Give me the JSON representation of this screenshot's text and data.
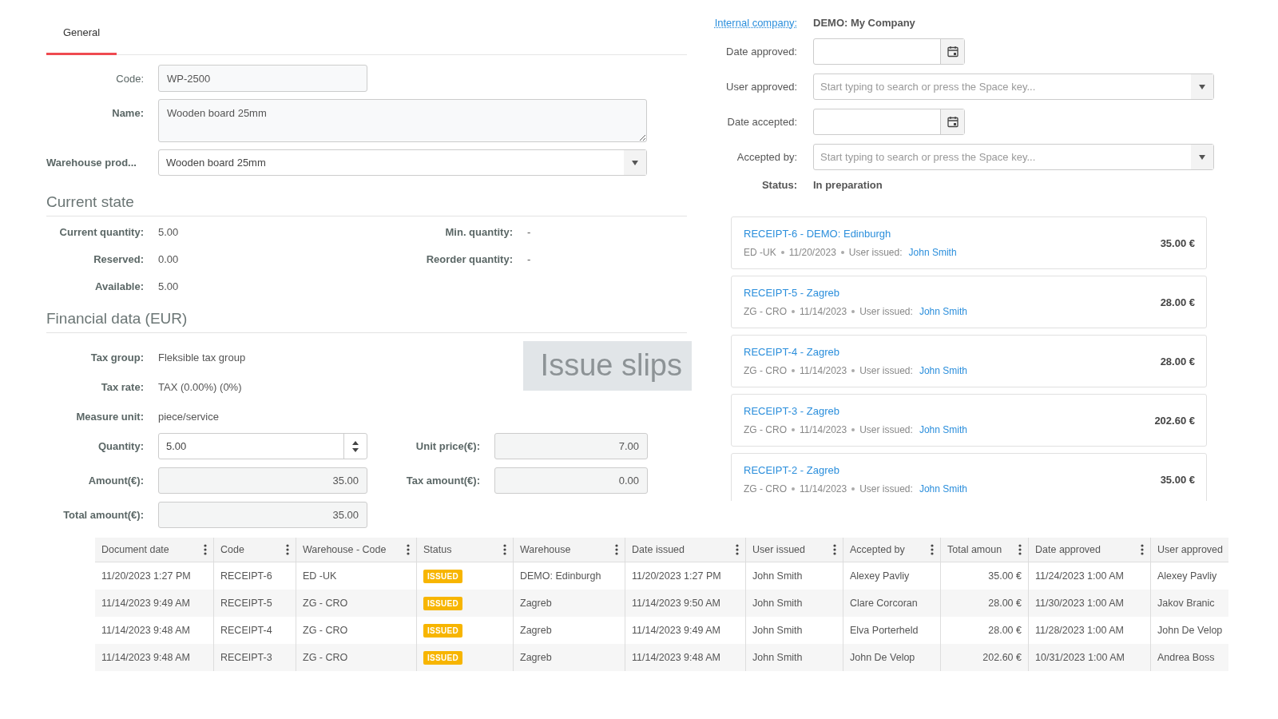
{
  "tabs": [
    {
      "label": "General",
      "selected": true
    }
  ],
  "form": {
    "code": {
      "label": "Code:",
      "value": "WP-2500"
    },
    "name": {
      "label": "Name:",
      "value": "Wooden board 25mm"
    },
    "warehouse_product": {
      "label": "Warehouse prod...",
      "value": "Wooden board 25mm"
    }
  },
  "current_state": {
    "title": "Current state",
    "rows": [
      {
        "label": "Current quantity:",
        "value": "5.00",
        "label_2": "Min. quantity:",
        "value_2": "-"
      },
      {
        "label": "Reserved:",
        "value": "0.00",
        "label_2": "Reorder quantity:",
        "value_2": "-"
      },
      {
        "label": "Available:",
        "value": "5.00"
      }
    ]
  },
  "financial": {
    "title": "Financial data (EUR)",
    "info": [
      {
        "label": "Tax group:",
        "value": "Fleksible tax group"
      },
      {
        "label": "Tax rate:",
        "value": "TAX (0.00%) (0%)"
      },
      {
        "label": "Measure unit:",
        "value": "piece/service"
      }
    ],
    "quantity": {
      "label": "Quantity:",
      "value": "5.00"
    },
    "unit_price": {
      "label": "Unit price(€):",
      "value": "7.00"
    },
    "amount": {
      "label": "Amount(€):",
      "value": "35.00"
    },
    "tax_amount": {
      "label": "Tax amount(€):",
      "value": "0.00"
    },
    "total_amount": {
      "label": "Total amount(€):",
      "value": "35.00"
    }
  },
  "overlay_label": "Issue slips",
  "approval": {
    "internal_company": {
      "label": "Internal company:",
      "value": "DEMO: My Company"
    },
    "fields": [
      {
        "kind": "date",
        "label": "Date approved:"
      },
      {
        "kind": "select",
        "label": "User approved:",
        "placeholder": "Start typing to search or press the Space key..."
      },
      {
        "kind": "date",
        "label": "Date accepted:"
      },
      {
        "kind": "select",
        "label": "Accepted by:",
        "placeholder": "Start typing to search or press the Space key..."
      }
    ],
    "status": {
      "label": "Status:",
      "value": "In preparation"
    }
  },
  "receipts": [
    {
      "title": "RECEIPT-6 - DEMO: Edinburgh",
      "warehouse_code": "ED -UK",
      "date": "11/20/2023",
      "user_label": "User issued:",
      "user": "John Smith",
      "amount": "35.00 €"
    },
    {
      "title": "RECEIPT-5 - Zagreb",
      "warehouse_code": "ZG - CRO",
      "date": "11/14/2023",
      "user_label": "User issued:",
      "user": "John Smith",
      "amount": "28.00 €"
    },
    {
      "title": "RECEIPT-4 - Zagreb",
      "warehouse_code": "ZG - CRO",
      "date": "11/14/2023",
      "user_label": "User issued:",
      "user": "John Smith",
      "amount": "28.00 €"
    },
    {
      "title": "RECEIPT-3 - Zagreb",
      "warehouse_code": "ZG - CRO",
      "date": "11/14/2023",
      "user_label": "User issued:",
      "user": "John Smith",
      "amount": "202.60 €"
    },
    {
      "title": "RECEIPT-2 - Zagreb",
      "warehouse_code": "ZG - CRO",
      "date": "11/14/2023",
      "user_label": "User issued:",
      "user": "John Smith",
      "amount": "35.00 €"
    }
  ],
  "table": {
    "columns": [
      {
        "label": "Document date",
        "kind": "text"
      },
      {
        "label": "Code",
        "kind": "text"
      },
      {
        "label": "Warehouse - Code",
        "kind": "text"
      },
      {
        "label": "Status",
        "kind": "badge"
      },
      {
        "label": "Warehouse",
        "kind": "text"
      },
      {
        "label": "Date issued",
        "kind": "text"
      },
      {
        "label": "User issued",
        "kind": "text"
      },
      {
        "label": "Accepted by",
        "kind": "text"
      },
      {
        "label": "Total amoun",
        "kind": "number"
      },
      {
        "label": "Date approved",
        "kind": "text"
      },
      {
        "label": "User approved",
        "kind": "text"
      }
    ],
    "rows": [
      [
        "11/20/2023 1:27 PM",
        "RECEIPT-6",
        "ED -UK",
        "ISSUED",
        "DEMO: Edinburgh",
        "11/20/2023 1:27 PM",
        "John Smith",
        "Alexey Pavliy",
        "35.00 €",
        "11/24/2023 1:00 AM",
        "Alexey Pavliy"
      ],
      [
        "11/14/2023 9:49 AM",
        "RECEIPT-5",
        "ZG - CRO",
        "ISSUED",
        "Zagreb",
        "11/14/2023 9:50 AM",
        "John Smith",
        "Clare Corcoran",
        "28.00 €",
        "11/30/2023 1:00 AM",
        "Jakov Branic"
      ],
      [
        "11/14/2023 9:48 AM",
        "RECEIPT-4",
        "ZG - CRO",
        "ISSUED",
        "Zagreb",
        "11/14/2023 9:49 AM",
        "John Smith",
        "Elva Porterheld",
        "28.00 €",
        "11/28/2023 1:00 AM",
        "John De Velop"
      ],
      [
        "11/14/2023 9:48 AM",
        "RECEIPT-3",
        "ZG - CRO",
        "ISSUED",
        "Zagreb",
        "11/14/2023 9:48 AM",
        "John Smith",
        "John De Velop",
        "202.60 €",
        "10/31/2023 1:00 AM",
        "Andrea Boss"
      ]
    ]
  }
}
